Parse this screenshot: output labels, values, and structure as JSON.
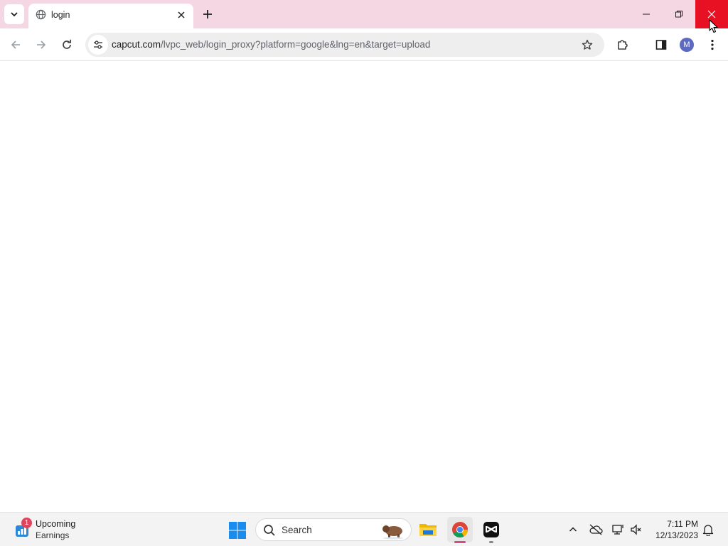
{
  "browser": {
    "tab": {
      "title": "login"
    },
    "address": {
      "host": "capcut.com",
      "path": "/lvpc_web/login_proxy?platform=google&lng=en&target=upload"
    },
    "profile_initial": "M"
  },
  "taskbar": {
    "widget": {
      "badge": "1",
      "title": "Upcoming",
      "subtitle": "Earnings"
    },
    "search": {
      "label": "Search"
    },
    "apps": [
      "file-explorer",
      "chrome",
      "capcut"
    ],
    "clock": {
      "time": "7:11 PM",
      "date": "12/13/2023"
    }
  },
  "colors": {
    "tabstrip": "#f4d7e3",
    "close_hover": "#e81123",
    "avatar": "#5c6bc0",
    "badge": "#e0445c"
  }
}
